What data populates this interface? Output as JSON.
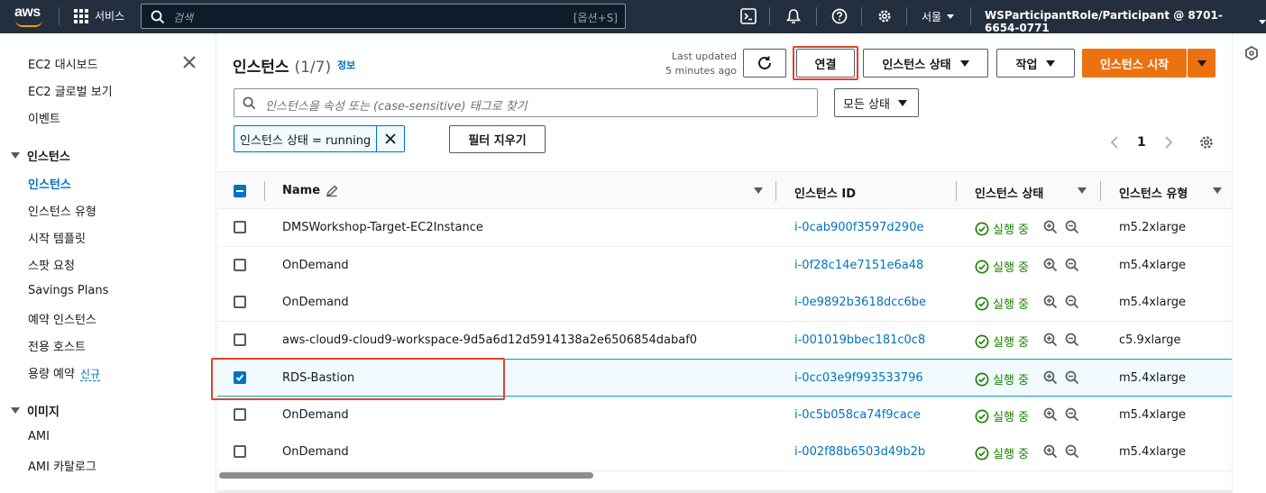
{
  "topnav": {
    "logo": "aws",
    "services": "서비스",
    "search_placeholder": "검색",
    "search_shortcut": "[옵션+S]",
    "region": "서울",
    "account": "WSParticipantRole/Participant @ 8701-6654-0771",
    "icons": [
      "terminal-icon",
      "bell-icon",
      "help-icon",
      "gear-icon"
    ]
  },
  "sidebar": {
    "top_items": [
      "EC2 대시보드",
      "EC2 글로벌 보기",
      "이벤트"
    ],
    "instances_section": "인스턴스",
    "instances_items": [
      "인스턴스",
      "인스턴스 유형",
      "시작 템플릿",
      "스팟 요청",
      "Savings Plans",
      "예약 인스턴스",
      "전용 호스트",
      "용량 예약"
    ],
    "new_badge": "신규",
    "images_section": "이미지",
    "images_items": [
      "AMI",
      "AMI 카탈로그"
    ]
  },
  "header": {
    "title": "인스턴스",
    "count": "(1/7)",
    "info": "정보",
    "last_updated_1": "Last updated",
    "last_updated_2": "5 minutes ago",
    "connect": "연결",
    "instance_state": "인스턴스 상태",
    "actions": "작업",
    "launch": "인스턴스 시작"
  },
  "filter": {
    "placeholder": "인스턴스을 속성 또는 (case-sensitive) 태그로 찾기",
    "state_select": "모든 상태",
    "token": "인스턴스 상태 = running",
    "clear": "필터 지우기",
    "page": "1"
  },
  "table": {
    "columns": [
      "Name",
      "인스턴스 ID",
      "인스턴스 상태",
      "인스턴스 유형"
    ],
    "rows": [
      {
        "name": "DMSWorkshop-Target-EC2Instance",
        "id": "i-0cab900f3597d290e",
        "state": "실행 중",
        "type": "m5.2xlarge",
        "selected": false
      },
      {
        "name": "OnDemand",
        "id": "i-0f28c14e7151e6a48",
        "state": "실행 중",
        "type": "m5.4xlarge",
        "selected": false
      },
      {
        "name": "OnDemand",
        "id": "i-0e9892b3618dcc6be",
        "state": "실행 중",
        "type": "m5.4xlarge",
        "selected": false
      },
      {
        "name": "aws-cloud9-cloud9-workspace-9d5a6d12d5914138a2e6506854dabaf0",
        "id": "i-001019bbec181c0c8",
        "state": "실행 중",
        "type": "c5.9xlarge",
        "selected": false
      },
      {
        "name": "RDS-Bastion",
        "id": "i-0cc03e9f993533796",
        "state": "실행 중",
        "type": "m5.4xlarge",
        "selected": true
      },
      {
        "name": "OnDemand",
        "id": "i-0c5b058ca74f9cace",
        "state": "실행 중",
        "type": "m5.4xlarge",
        "selected": false
      },
      {
        "name": "OnDemand",
        "id": "i-002f88b6503d49b2b",
        "state": "실행 중",
        "type": "m5.4xlarge",
        "selected": false
      }
    ]
  },
  "colors": {
    "nav_bg": "#232f3e",
    "accent_orange": "#ec7211",
    "link_blue": "#0073bb",
    "success_green": "#1d8102",
    "highlight_red": "#e0412c"
  }
}
